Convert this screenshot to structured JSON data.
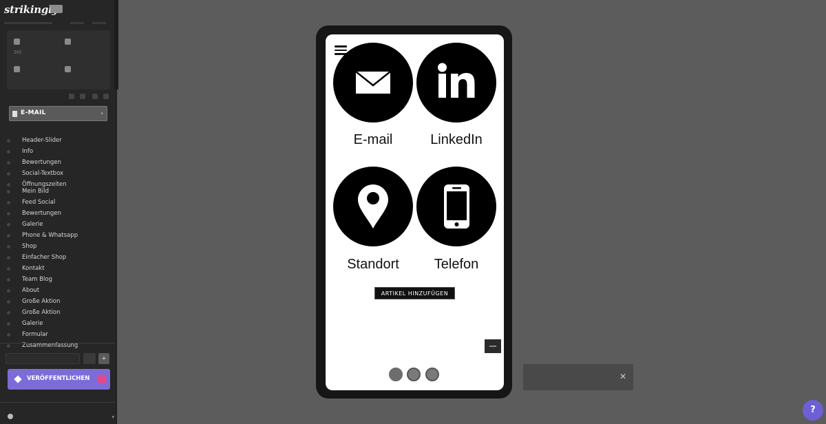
{
  "sidebar": {
    "logo": "strikingly",
    "panel_tiles": [
      {
        "label": "Stil"
      },
      {
        "label": ""
      },
      {
        "label": ""
      },
      {
        "label": ""
      }
    ],
    "section_select": {
      "label": "E-MAIL"
    },
    "sections_label": "",
    "sections": [
      "Header-Slider",
      "Info",
      "Bewertungen",
      "Social-Textbox",
      "Öffnungszeiten",
      "Mein Bild",
      "Feed Social",
      "Bewertungen",
      "Galerie",
      "Phone & Whatsapp",
      "Shop",
      "Einfacher Shop",
      "Kontakt",
      "Team Blog",
      "About",
      "Große Aktion",
      "Große Aktion",
      "Galerie",
      "Formular",
      "Zusammenfassung"
    ],
    "search_placeholder": "",
    "publish_label": "VERÖFFENTLICHEN",
    "account": {
      "line1": "",
      "line2": ""
    }
  },
  "preview": {
    "contacts": [
      {
        "label": "E-mail",
        "icon": "envelope-icon"
      },
      {
        "label": "LinkedIn",
        "icon": "linkedin-icon"
      },
      {
        "label": "Standort",
        "icon": "location-pin-icon"
      },
      {
        "label": "Telefon",
        "icon": "phone-icon"
      }
    ],
    "add_item_label": "ARTIKEL HINZUFÜGEN"
  },
  "toast": {
    "line1": "",
    "line2": "",
    "close": "✕"
  },
  "help": {
    "label": "?"
  },
  "colors": {
    "canvas": "#5c5c5c",
    "sidebar": "#262626",
    "publish": "#7b6cd8",
    "circle": "#000000"
  }
}
